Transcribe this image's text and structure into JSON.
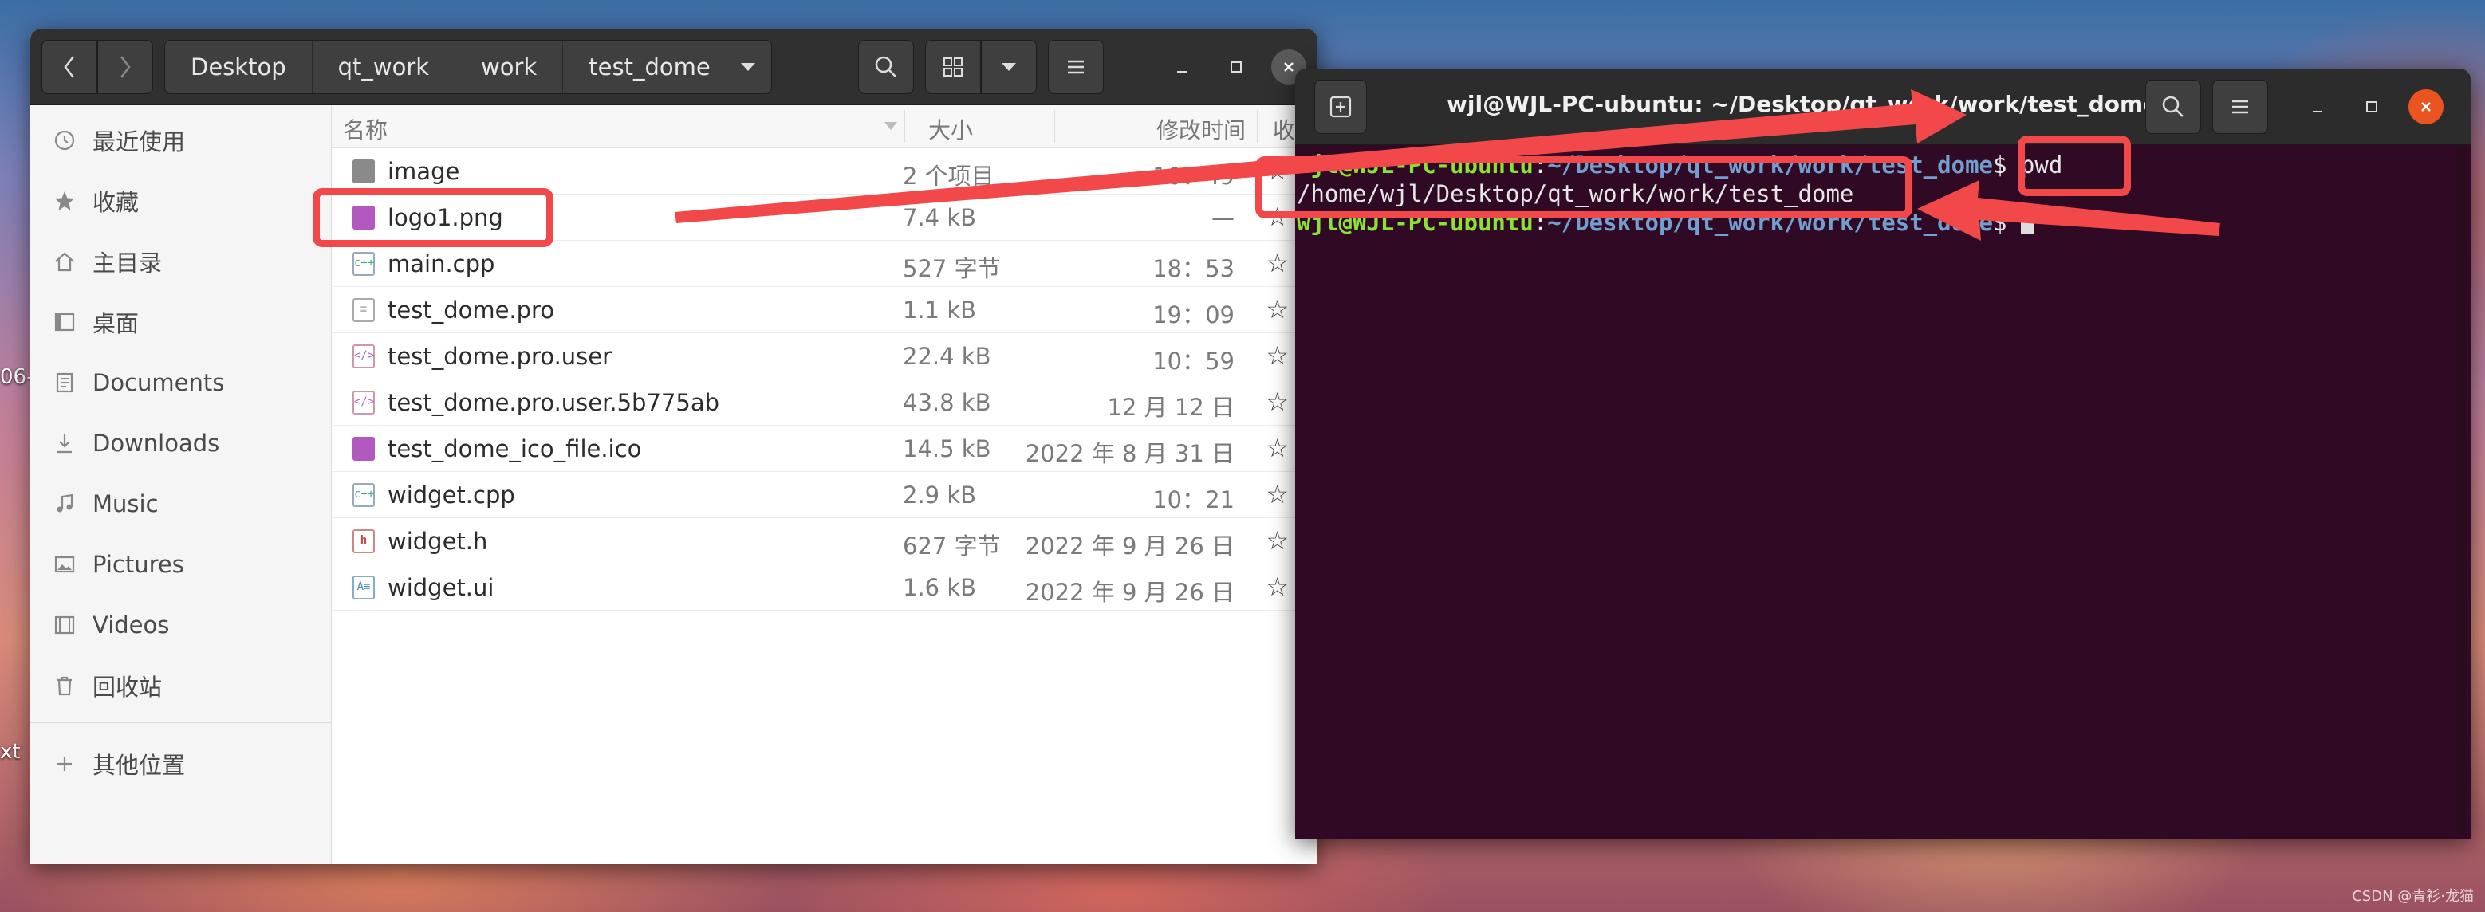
{
  "desktop": {
    "label_left_1": "06-",
    "label_left_2": "xt",
    "watermark": "CSDN @青衫·龙猫"
  },
  "file_manager": {
    "nav_back_icon": "chevron-left-icon",
    "nav_forward_icon": "chevron-right-icon",
    "breadcrumb": [
      "Desktop",
      "qt_work",
      "work",
      "test_dome"
    ],
    "toolbar_icons": [
      "search-icon",
      "grid-view-icon",
      "dropdown-icon",
      "menu-icon"
    ],
    "window_controls": [
      "minimize-icon",
      "maximize-icon",
      "close-icon"
    ],
    "sidebar": [
      {
        "label": "最近使用",
        "icon": "clock-icon"
      },
      {
        "label": "收藏",
        "icon": "star-icon"
      },
      {
        "label": "主目录",
        "icon": "home-icon"
      },
      {
        "label": "桌面",
        "icon": "desktop-icon"
      },
      {
        "label": "Documents",
        "icon": "document-icon"
      },
      {
        "label": "Downloads",
        "icon": "download-icon"
      },
      {
        "label": "Music",
        "icon": "music-icon"
      },
      {
        "label": "Pictures",
        "icon": "picture-icon"
      },
      {
        "label": "Videos",
        "icon": "video-icon"
      },
      {
        "label": "回收站",
        "icon": "trash-icon"
      },
      {
        "label": "其他位置",
        "icon": "plus-icon"
      }
    ],
    "columns": {
      "name": "名称",
      "size": "大小",
      "modified": "修改时间",
      "starred": "收藏"
    },
    "files": [
      {
        "name": "image",
        "size": "2 个项目",
        "modified": "10：49",
        "type": "folder"
      },
      {
        "name": "logo1.png",
        "size": "7.4 kB",
        "modified": "—",
        "type": "image"
      },
      {
        "name": "main.cpp",
        "size": "527 字节",
        "modified": "18：53",
        "type": "code"
      },
      {
        "name": "test_dome.pro",
        "size": "1.1 kB",
        "modified": "19：09",
        "type": "text"
      },
      {
        "name": "test_dome.pro.user",
        "size": "22.4 kB",
        "modified": "10：59",
        "type": "xml"
      },
      {
        "name": "test_dome.pro.user.5b775ab",
        "size": "43.8 kB",
        "modified": "12 月 12 日",
        "type": "xml"
      },
      {
        "name": "test_dome_ico_file.ico",
        "size": "14.5 kB",
        "modified": "2022 年 8 月 31 日",
        "type": "image"
      },
      {
        "name": "widget.cpp",
        "size": "2.9 kB",
        "modified": "10：21",
        "type": "code"
      },
      {
        "name": "widget.h",
        "size": "627 字节",
        "modified": "2022 年 9 月 26 日",
        "type": "h"
      },
      {
        "name": "widget.ui",
        "size": "1.6 kB",
        "modified": "2022 年 9 月 26 日",
        "type": "ui"
      }
    ]
  },
  "terminal": {
    "title": "wjl@WJL-PC-ubuntu: ~/Desktop/qt_work/work/test_dome",
    "prompt_user": "wjl@WJL-PC-ubuntu",
    "prompt_sep": ":",
    "prompt_path": "~/Desktop/qt_work/work/test_dome",
    "prompt_end": "$ ",
    "command": "pwd",
    "output": "/home/wjl/Desktop/qt_work/work/test_dome",
    "header_icons": [
      "new-tab-icon",
      "search-icon",
      "menu-icon",
      "minimize-icon",
      "maximize-icon",
      "close-icon"
    ],
    "colors": {
      "background": "#300a24",
      "user": "#8ae234",
      "path": "#729fcf",
      "close": "#e95420"
    }
  },
  "annotation_color": "#f2484a"
}
